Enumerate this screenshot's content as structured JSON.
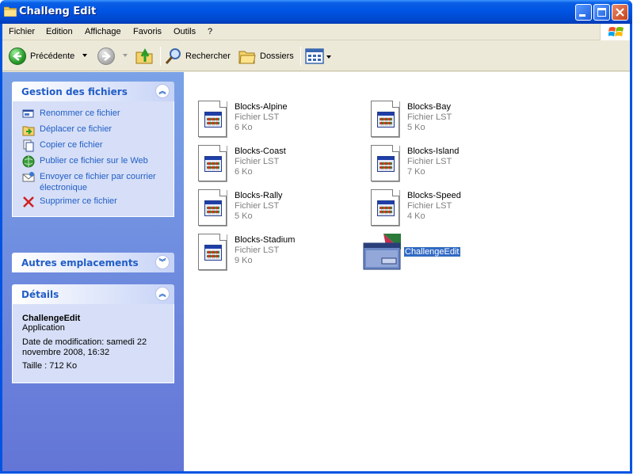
{
  "window": {
    "title": "Challeng Edit"
  },
  "menu": [
    "Fichier",
    "Edition",
    "Affichage",
    "Favoris",
    "Outils",
    "?"
  ],
  "toolbar": {
    "back_label": "Précédente",
    "search_label": "Rechercher",
    "folders_label": "Dossiers"
  },
  "tasks_panel": {
    "title": "Gestion des fichiers",
    "items": [
      {
        "label": "Renommer ce fichier",
        "icon": "rename-icon"
      },
      {
        "label": "Déplacer ce fichier",
        "icon": "move-icon"
      },
      {
        "label": "Copier ce fichier",
        "icon": "copy-icon"
      },
      {
        "label": "Publier ce fichier sur le Web",
        "icon": "web-publish-icon"
      },
      {
        "label": "Envoyer ce fichier par courrier électronique",
        "icon": "email-icon"
      },
      {
        "label": "Supprimer ce fichier",
        "icon": "delete-icon"
      }
    ]
  },
  "other_places_panel": {
    "title": "Autres emplacements"
  },
  "details_panel": {
    "title": "Détails",
    "name": "ChallengeEdit",
    "type": "Application",
    "modified": "Date de modification: samedi 22 novembre 2008, 16:32",
    "size": "Taille : 712 Ko"
  },
  "files": [
    {
      "name": "Blocks-Alpine",
      "type": "Fichier LST",
      "size": "6 Ko"
    },
    {
      "name": "Blocks-Bay",
      "type": "Fichier LST",
      "size": "5 Ko"
    },
    {
      "name": "Blocks-Coast",
      "type": "Fichier LST",
      "size": "6 Ko"
    },
    {
      "name": "Blocks-Island",
      "type": "Fichier LST",
      "size": "7 Ko"
    },
    {
      "name": "Blocks-Rally",
      "type": "Fichier LST",
      "size": "5 Ko"
    },
    {
      "name": "Blocks-Speed",
      "type": "Fichier LST",
      "size": "4 Ko"
    },
    {
      "name": "Blocks-Stadium",
      "type": "Fichier LST",
      "size": "9 Ko"
    }
  ],
  "selected_app": {
    "name": "ChallengeEdit"
  },
  "colors": {
    "title_bar": "#0054e3",
    "task_pane": "#6375d6",
    "link": "#215dc6",
    "selection": "#316ac5"
  }
}
